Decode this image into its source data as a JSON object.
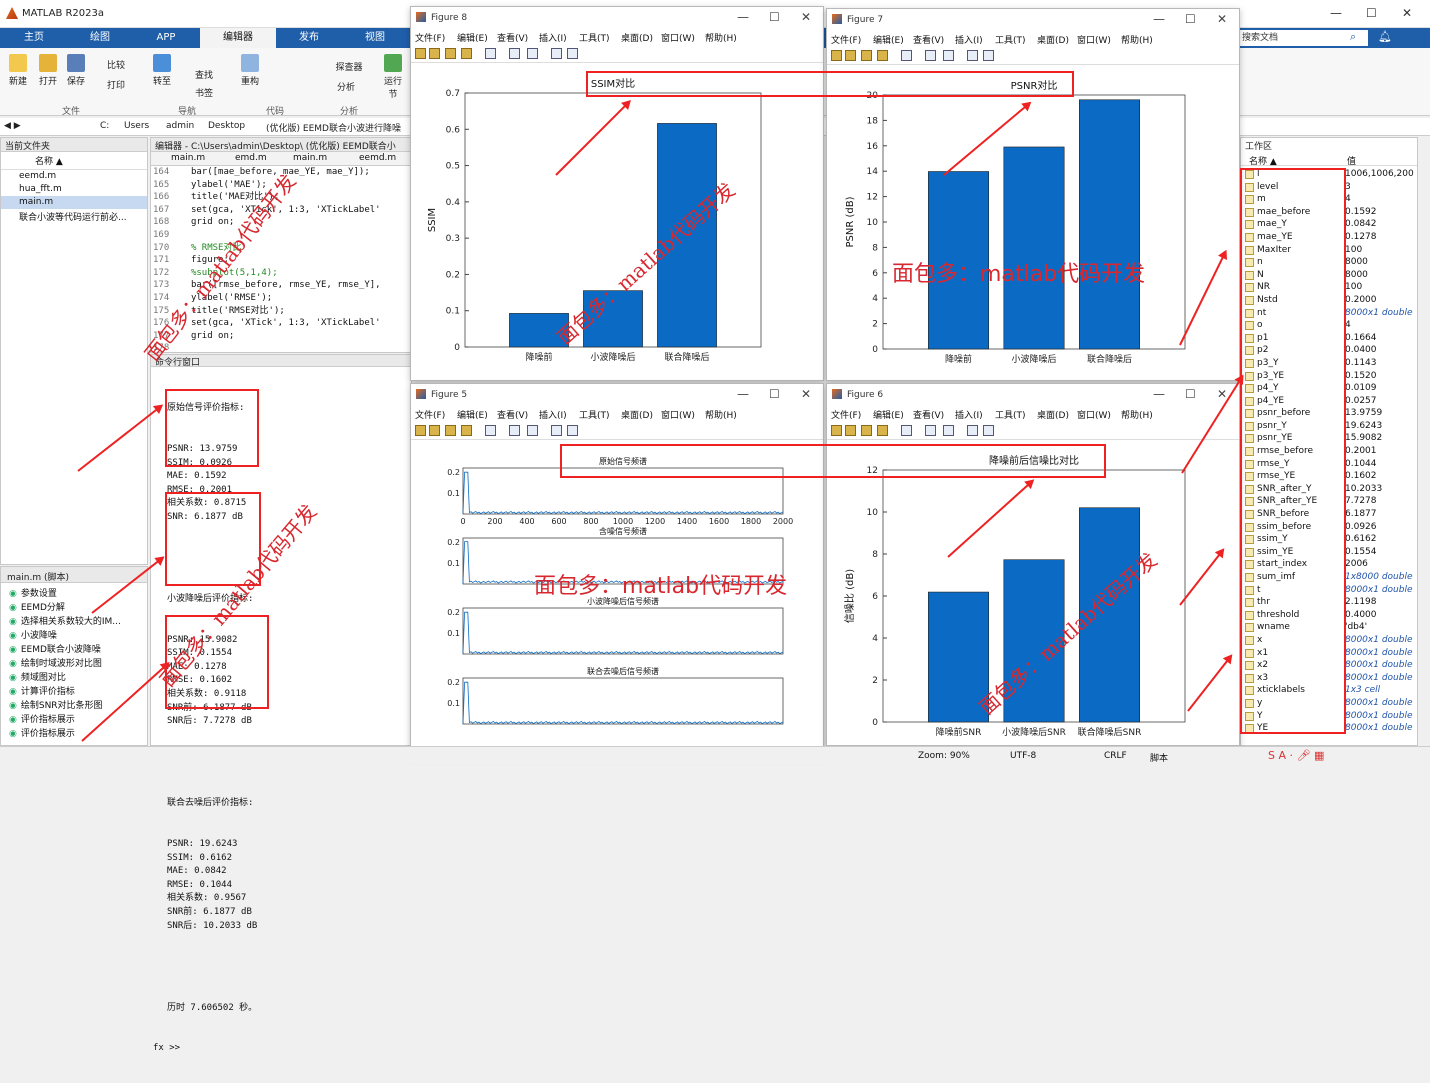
{
  "app": {
    "title": "MATLAB R2023a",
    "min": "—",
    "max": "☐",
    "close": "✕"
  },
  "tabs": [
    "主页",
    "绘图",
    "APP",
    "编辑器",
    "发布",
    "视图"
  ],
  "ribbon": {
    "buttons": [
      "新建",
      "打开",
      "保存",
      "比较",
      "打印",
      "转至",
      "查找",
      "书签",
      "重构",
      "探查器",
      "分析",
      "运行节"
    ],
    "sections": [
      "文件",
      "导航",
      "代码",
      "分析"
    ]
  },
  "search_placeholder": "搜索文档",
  "address": [
    "C:",
    "Users",
    "admin",
    "Desktop",
    "(优化版) EEMD联合小波进行降噪"
  ],
  "current_folder": {
    "title": "当前文件夹",
    "col": "名称 ▲",
    "files": [
      "eemd.m",
      "hua_fft.m",
      "main.m",
      "联合小波等代码运行前必..."
    ]
  },
  "editor": {
    "path": "编辑器 - C:\\Users\\admin\\Desktop\\ (优化版) EEMD联合小",
    "tabs": [
      "main.m",
      "emd.m",
      "main.m",
      "eemd.m"
    ],
    "lines": [
      {
        "n": "164",
        "t": "    bar([mae_before, mae_YE, mae_Y]);"
      },
      {
        "n": "165",
        "t": "    ylabel('MAE');"
      },
      {
        "n": "166",
        "t": "    title('MAE对比');"
      },
      {
        "n": "167",
        "t": "    set(gca, 'XTick', 1:3, 'XTickLabel'"
      },
      {
        "n": "168",
        "t": "    grid on;"
      },
      {
        "n": "169",
        "t": ""
      },
      {
        "n": "170",
        "t": "    % RMSE对比"
      },
      {
        "n": "171",
        "t": "    figure;"
      },
      {
        "n": "172",
        "t": "    %subplot(5,1,4);"
      },
      {
        "n": "173",
        "t": "    bar([rmse_before, rmse_YE, rmse_Y],"
      },
      {
        "n": "174",
        "t": "    ylabel('RMSE');"
      },
      {
        "n": "175",
        "t": "    title('RMSE对比');"
      },
      {
        "n": "176",
        "t": "    set(gca, 'XTick', 1:3, 'XTickLabel'"
      },
      {
        "n": "177",
        "t": "    grid on;"
      },
      {
        "n": "178",
        "t": ""
      }
    ]
  },
  "command": {
    "title": "命令行窗口",
    "orig_head": "原始信号评价指标:",
    "orig": [
      "PSNR: 13.9759",
      "SSIM: 0.0926",
      "MAE: 0.1592",
      "RMSE: 0.2001",
      "相关系数: 0.8715",
      "SNR: 6.1877 dB"
    ],
    "wav_head": "小波降噪后评价指标:",
    "wav": [
      "PSNR: 15.9082",
      "SSIM: 0.1554",
      "MAE: 0.1278",
      "RMSE: 0.1602",
      "相关系数: 0.9118",
      "SNR前: 6.1877 dB",
      "SNR后: 7.7278 dB"
    ],
    "joint_head": "联合去噪后评价指标:",
    "joint": [
      "PSNR: 19.6243",
      "SSIM: 0.6162",
      "MAE: 0.0842",
      "RMSE: 0.1044",
      "相关系数: 0.9567",
      "SNR前: 6.1877 dB",
      "SNR后: 10.2033 dB"
    ],
    "elapsed": "历时 7.606502 秒。",
    "prompt": "fx >>"
  },
  "outline": {
    "title": "main.m (脚本)",
    "items": [
      "参数设置",
      "EEMD分解",
      "选择相关系数较大的IM...",
      "小波降噪",
      "EEMD联合小波降噪",
      "绘制时域波形对比图",
      "频域图对比",
      "计算评价指标",
      "绘制SNR对比条形图",
      "评价指标展示",
      "评价指标展示"
    ]
  },
  "figure_menu": [
    "文件(F)",
    "编辑(E)",
    "查看(V)",
    "插入(I)",
    "工具(T)",
    "桌面(D)",
    "窗口(W)",
    "帮助(H)"
  ],
  "fig8": {
    "title": "Figure 8",
    "chart_data": {
      "type": "bar",
      "title": "SSIM对比",
      "xlabel": "",
      "ylabel": "SSIM",
      "categories": [
        "降噪前",
        "小波降噪后",
        "联合降噪后"
      ],
      "values": [
        0.0926,
        0.1554,
        0.6162
      ],
      "ylim": [
        0,
        0.7
      ],
      "yticks": [
        0,
        0.1,
        0.2,
        0.3,
        0.4,
        0.5,
        0.6,
        0.7
      ],
      "color": "#0b6bc4"
    }
  },
  "fig7": {
    "title": "Figure 7",
    "chart_data": {
      "type": "bar",
      "title": "PSNR对比",
      "xlabel": "",
      "ylabel": "PSNR (dB)",
      "categories": [
        "降噪前",
        "小波降噪后",
        "联合降噪后"
      ],
      "values": [
        13.9759,
        15.9082,
        19.6243
      ],
      "ylim": [
        0,
        20
      ],
      "yticks": [
        0,
        2,
        4,
        6,
        8,
        10,
        12,
        14,
        16,
        18,
        20
      ],
      "color": "#0b6bc4"
    }
  },
  "fig5": {
    "title": "Figure 5",
    "chart_data": {
      "type": "line",
      "panels": [
        {
          "title": "原始信号频谱",
          "xlim": [
            0,
            2000
          ],
          "ylim": [
            0,
            0.22
          ],
          "yticks": [
            0.1,
            0.2
          ]
        },
        {
          "title": "含噪信号频谱",
          "xlim": [
            0,
            2000
          ],
          "ylim": [
            0,
            0.22
          ],
          "yticks": [
            0.1,
            0.2
          ]
        },
        {
          "title": "小波降噪后信号频谱",
          "xlim": [
            0,
            2000
          ],
          "ylim": [
            0,
            0.22
          ],
          "yticks": [
            0.1,
            0.2
          ]
        },
        {
          "title": "联合去噪后信号频谱",
          "xlim": [
            0,
            2000
          ],
          "ylim": [
            0,
            0.22
          ],
          "yticks": [
            0.1,
            0.2
          ]
        }
      ],
      "xticks": [
        0,
        200,
        400,
        600,
        800,
        1000,
        1200,
        1400,
        1600,
        1800,
        2000
      ]
    }
  },
  "fig6": {
    "title": "Figure 6",
    "chart_data": {
      "type": "bar",
      "title": "降噪前后信噪比对比",
      "xlabel": "",
      "ylabel": "信噪比 (dB)",
      "categories": [
        "降噪前SNR",
        "小波降噪后SNR",
        "联合降噪后SNR"
      ],
      "values": [
        6.1877,
        7.7278,
        10.2033
      ],
      "ylim": [
        0,
        12
      ],
      "yticks": [
        0,
        2,
        4,
        6,
        8,
        10,
        12
      ],
      "color": "#0b6bc4"
    }
  },
  "workspace": {
    "title": "工作区",
    "cols": [
      "名称 ▲",
      "值"
    ],
    "rows": [
      [
        "l",
        "1006,1006,200"
      ],
      [
        "level",
        "3"
      ],
      [
        "m",
        "4"
      ],
      [
        "mae_before",
        "0.1592"
      ],
      [
        "mae_Y",
        "0.0842"
      ],
      [
        "mae_YE",
        "0.1278"
      ],
      [
        "MaxIter",
        "100"
      ],
      [
        "n",
        "8000"
      ],
      [
        "N",
        "8000"
      ],
      [
        "NR",
        "100"
      ],
      [
        "Nstd",
        "0.2000"
      ],
      [
        "nt",
        "8000x1 double"
      ],
      [
        "o",
        "4"
      ],
      [
        "p1",
        "0.1664"
      ],
      [
        "p2",
        "0.0400"
      ],
      [
        "p3_Y",
        "0.1143"
      ],
      [
        "p3_YE",
        "0.1520"
      ],
      [
        "p4_Y",
        "0.0109"
      ],
      [
        "p4_YE",
        "0.0257"
      ],
      [
        "psnr_before",
        "13.9759"
      ],
      [
        "psnr_Y",
        "19.6243"
      ],
      [
        "psnr_YE",
        "15.9082"
      ],
      [
        "rmse_before",
        "0.2001"
      ],
      [
        "rmse_Y",
        "0.1044"
      ],
      [
        "rmse_YE",
        "0.1602"
      ],
      [
        "SNR_after_Y",
        "10.2033"
      ],
      [
        "SNR_after_YE",
        "7.7278"
      ],
      [
        "SNR_before",
        "6.1877"
      ],
      [
        "ssim_before",
        "0.0926"
      ],
      [
        "ssim_Y",
        "0.6162"
      ],
      [
        "ssim_YE",
        "0.1554"
      ],
      [
        "start_index",
        "2006"
      ],
      [
        "sum_imf",
        "1x8000 double"
      ],
      [
        "t",
        "8000x1 double"
      ],
      [
        "thr",
        "2.1198"
      ],
      [
        "threshold",
        "0.4000"
      ],
      [
        "wname",
        "'db4'"
      ],
      [
        "x",
        "8000x1 double"
      ],
      [
        "x1",
        "8000x1 double"
      ],
      [
        "x2",
        "8000x1 double"
      ],
      [
        "x3",
        "8000x1 double"
      ],
      [
        "xticklabels",
        "1x3 cell"
      ],
      [
        "y",
        "8000x1 double"
      ],
      [
        "Y",
        "8000x1 double"
      ],
      [
        "YE",
        "8000x1 double"
      ]
    ]
  },
  "status": {
    "zoom": "Zoom: 90%",
    "enc": "UTF-8",
    "eol": "CRLF",
    "mode": "脚本"
  },
  "watermark": "面包多：matlab代码开发"
}
